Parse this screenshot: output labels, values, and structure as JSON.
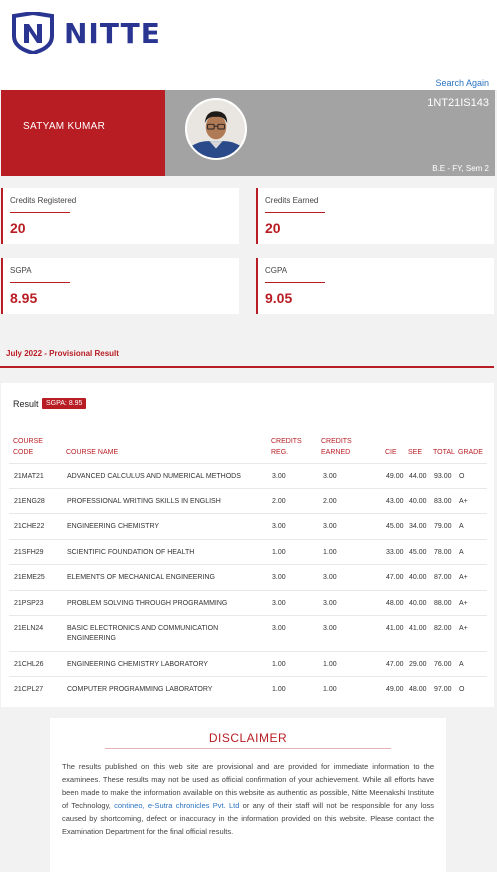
{
  "header": {
    "brand": "NITTE",
    "search_again": "Search Again"
  },
  "student": {
    "name": "SATYAM KUMAR",
    "usn": "1NT21IS143",
    "program": "B.E - FY, Sem 2"
  },
  "stats": [
    {
      "label": "Credits Registered",
      "value": "20"
    },
    {
      "label": "Credits Earned",
      "value": "20"
    },
    {
      "label": "SGPA",
      "value": "8.95"
    },
    {
      "label": "CGPA",
      "value": "9.05"
    }
  ],
  "result": {
    "title": "July 2022 - Provisional Result",
    "label": "Result",
    "sgpa_badge": "SGPA: 8.95",
    "columns": {
      "code_1": "COURSE",
      "code_2": "CODE",
      "name": "COURSE NAME",
      "reg_1": "CREDITS",
      "reg_2": "REG.",
      "earned_1": "CREDITS",
      "earned_2": "EARNED",
      "cie": "CIE",
      "see": "SEE",
      "total": "TOTAL",
      "grade": "GRADE"
    },
    "rows": [
      {
        "code": "21MAT21",
        "name": "ADVANCED CALCULUS AND NUMERICAL METHODS",
        "reg": "3.00",
        "earned": "3.00",
        "cie": "49.00",
        "see": "44.00",
        "total": "93.00",
        "grade": "O"
      },
      {
        "code": "21ENG28",
        "name": "PROFESSIONAL WRITING SKILLS IN ENGLISH",
        "reg": "2.00",
        "earned": "2.00",
        "cie": "43.00",
        "see": "40.00",
        "total": "83.00",
        "grade": "A+"
      },
      {
        "code": "21CHE22",
        "name": "ENGINEERING CHEMISTRY",
        "reg": "3.00",
        "earned": "3.00",
        "cie": "45.00",
        "see": "34.00",
        "total": "79.00",
        "grade": "A"
      },
      {
        "code": "21SFH29",
        "name": "SCIENTIFIC FOUNDATION OF HEALTH",
        "reg": "1.00",
        "earned": "1.00",
        "cie": "33.00",
        "see": "45.00",
        "total": "78.00",
        "grade": "A"
      },
      {
        "code": "21EME25",
        "name": "ELEMENTS OF MECHANICAL ENGINEERING",
        "reg": "3.00",
        "earned": "3.00",
        "cie": "47.00",
        "see": "40.00",
        "total": "87.00",
        "grade": "A+"
      },
      {
        "code": "21PSP23",
        "name": "PROBLEM SOLVING THROUGH PROGRAMMING",
        "reg": "3.00",
        "earned": "3.00",
        "cie": "48.00",
        "see": "40.00",
        "total": "88.00",
        "grade": "A+"
      },
      {
        "code": "21ELN24",
        "name": "BASIC ELECTRONICS AND COMMUNICATION ENGINEERING",
        "reg": "3.00",
        "earned": "3.00",
        "cie": "41.00",
        "see": "41.00",
        "total": "82.00",
        "grade": "A+"
      },
      {
        "code": "21CHL26",
        "name": "ENGINEERING CHEMISTRY LABORATORY",
        "reg": "1.00",
        "earned": "1.00",
        "cie": "47.00",
        "see": "29.00",
        "total": "76.00",
        "grade": "A"
      },
      {
        "code": "21CPL27",
        "name": "COMPUTER PROGRAMMING LABORATORY",
        "reg": "1.00",
        "earned": "1.00",
        "cie": "49.00",
        "see": "48.00",
        "total": "97.00",
        "grade": "O"
      }
    ]
  },
  "disclaimer": {
    "title": "DISCLAIMER",
    "text_before": "The results published on this web site are provisional and are provided for immediate information to the examinees. These results may not be used as official confirmation of your achievement. While all efforts have been made to make the information available on this website as authentic as possible, Nitte Meenakshi Institute of Technology, ",
    "link": "contineo, e-Sutra chronicles Pvt. Ltd",
    "text_after": " or any of their staff will not be responsible for any loss caused by shortcoming, defect or inaccuracy in the information provided on this website. Please contact the Examination Department for the final official results."
  },
  "colors": {
    "accent": "#b81d24",
    "brand": "#2a3591",
    "link": "#2a73c0",
    "panel_gray": "#a3a3a3"
  }
}
